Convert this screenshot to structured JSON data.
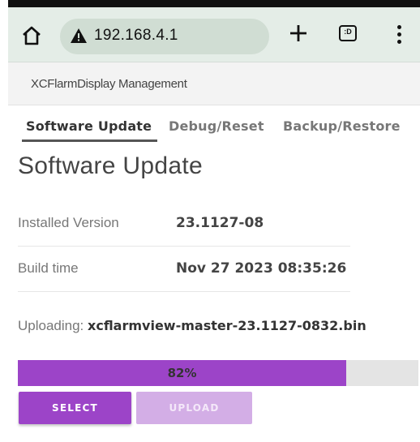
{
  "browser": {
    "url": "192.168.4.1",
    "tab_count": ":D",
    "icons": {
      "home": "home-icon",
      "warning": "not-secure-warning-icon",
      "new_tab": "plus-icon",
      "tabs": "tab-switcher-icon",
      "menu": "more-vert-icon"
    }
  },
  "app": {
    "title": "XCFlarmDisplay Management"
  },
  "tabs": [
    {
      "label": "Software Update",
      "active": true
    },
    {
      "label": "Debug/Reset",
      "active": false
    },
    {
      "label": "Backup/Restore",
      "active": false
    }
  ],
  "page": {
    "title": "Software Update"
  },
  "info": [
    {
      "label": "Installed Version",
      "value": "23.1127-08"
    },
    {
      "label": "Build time",
      "value": "Nov 27 2023 08:35:26"
    }
  ],
  "upload": {
    "status_label": "Uploading:",
    "filename": "xcflarmview-master-23.1127-0832.bin",
    "progress_percent": 82,
    "progress_label": "82%"
  },
  "buttons": {
    "select": "SELECT",
    "upload": "UPLOAD"
  },
  "colors": {
    "accent": "#9c44c8",
    "accent_disabled": "#d3aee6",
    "chrome_bg": "#e4ede7"
  }
}
